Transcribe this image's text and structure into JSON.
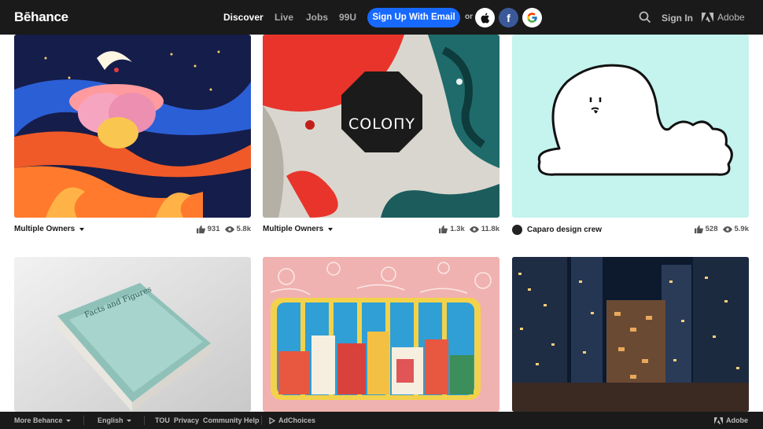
{
  "header": {
    "logo": "Bēhance",
    "nav": [
      "Discover",
      "Live",
      "Jobs",
      "99U"
    ],
    "signup_label": "Sign Up With Email",
    "or_label": "or",
    "facebook_glyph": "f",
    "signin_label": "Sign In",
    "adobe_label": "Adobe",
    "accent_color": "#1769ff"
  },
  "projects": [
    {
      "owner": "Multiple Owners",
      "appreciations": "931",
      "views": "5.8k"
    },
    {
      "owner": "Multiple Owners",
      "appreciations": "1.3k",
      "views": "11.8k",
      "cover_text": "COLOПY"
    },
    {
      "owner": "Caparo design crew",
      "appreciations": "528",
      "views": "5.9k"
    },
    {
      "book_title": "Facts and Figures"
    },
    {},
    {}
  ],
  "footer": {
    "more": "More Behance",
    "language": "English",
    "links": [
      "TOU",
      "Privacy",
      "Community",
      "Help"
    ],
    "adchoices": "AdChoices",
    "adobe": "Adobe"
  }
}
